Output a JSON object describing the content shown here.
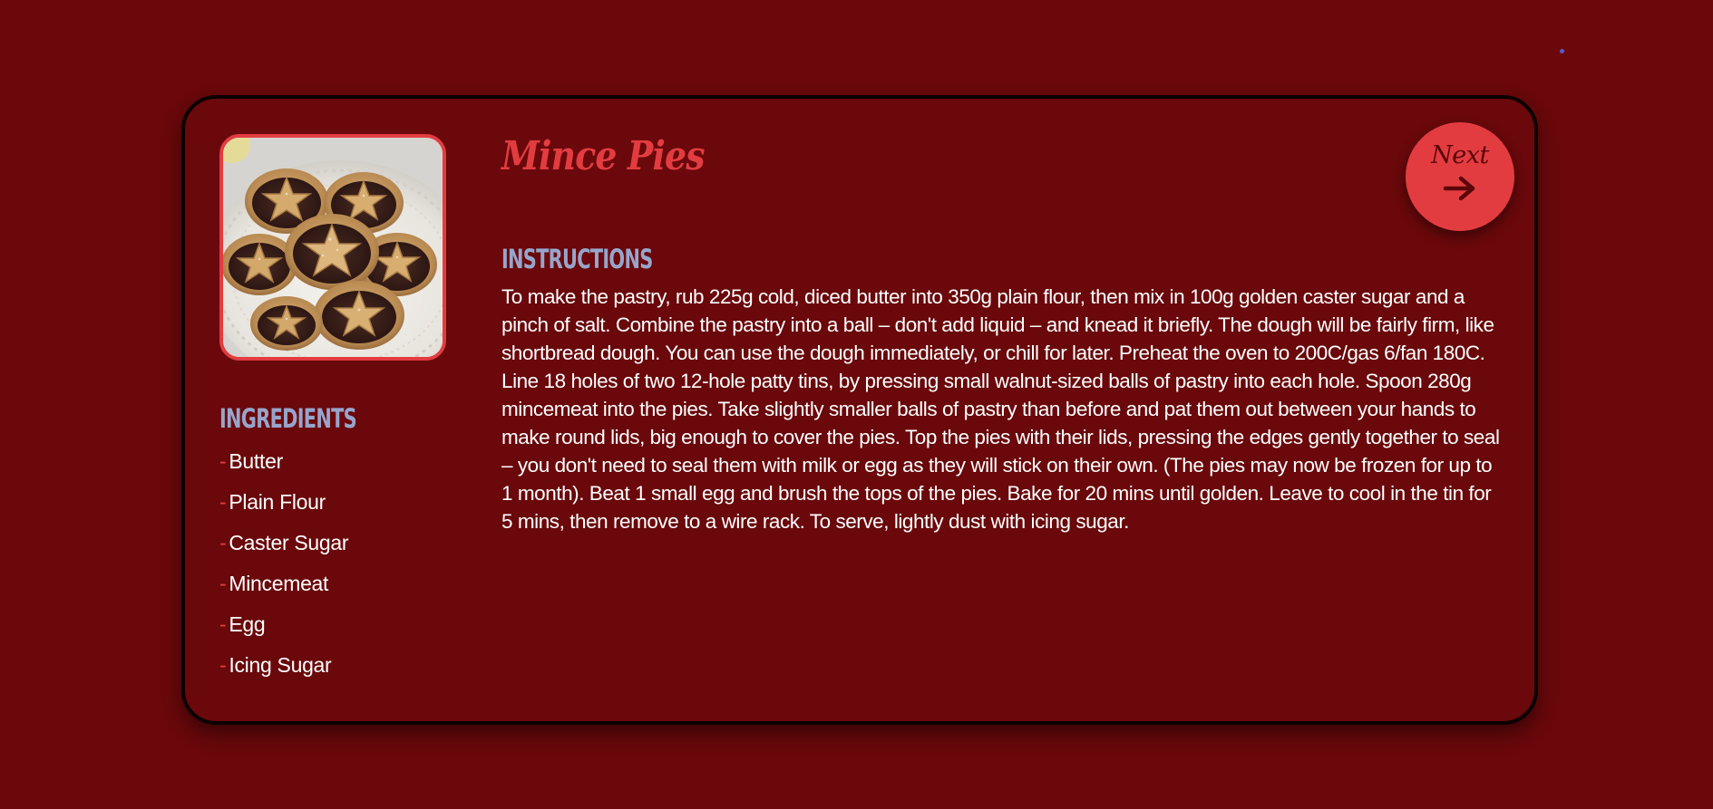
{
  "recipe": {
    "title": "Mince Pies",
    "image_alt": "mince-pies-photo"
  },
  "ingredients": {
    "heading": "INGREDIENTS",
    "bullet": "-",
    "items": [
      "Butter",
      "Plain Flour",
      "Caster Sugar",
      "Mincemeat",
      "Egg",
      "Icing Sugar"
    ]
  },
  "instructions": {
    "heading": "INSTRUCTIONS",
    "text": "To make the pastry, rub 225g cold, diced butter into 350g plain flour, then mix in 100g golden caster sugar and a pinch of salt. Combine the pastry into a ball – don't add liquid – and knead it briefly. The dough will be fairly firm, like shortbread dough. You can use the dough immediately, or chill for later. Preheat the oven to 200C/gas 6/fan 180C. Line 18 holes of two 12-hole patty tins, by pressing small walnut-sized balls of pastry into each hole. Spoon 280g mincemeat into the pies. Take slightly smaller balls of pastry than before and pat them out between your hands to make round lids, big enough to cover the pies. Top the pies with their lids, pressing the edges gently together to seal – you don't need to seal them with milk or egg as they will stick on their own. (The pies may now be frozen for up to 1 month). Beat 1 small egg and brush the tops of the pies. Bake for 20 mins until golden. Leave to cool in the tin for 5 mins, then remove to a wire rack. To serve, lightly dust with icing sugar."
  },
  "navigation": {
    "next_label": "Next",
    "next_icon": "arrow-right-icon"
  },
  "colors": {
    "background": "#6a080b",
    "accent": "#e23c41",
    "heading": "#97a5cb",
    "text": "#ffffff",
    "border": "#0c0000"
  }
}
